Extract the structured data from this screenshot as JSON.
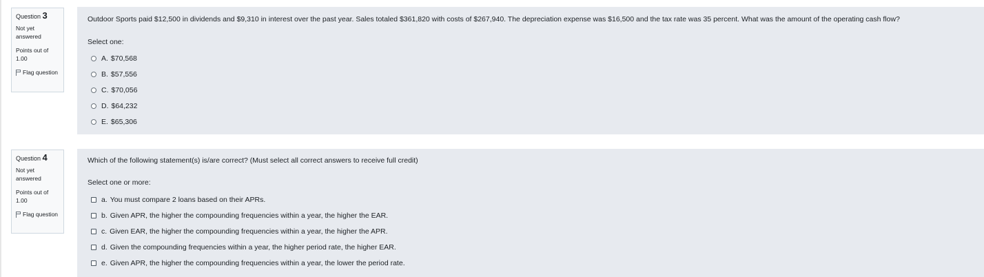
{
  "questions": [
    {
      "number_prefix": "Question",
      "number": "3",
      "state": "Not yet answered",
      "grade": "Points out of 1.00",
      "flag_label": "Flag question",
      "text": "Outdoor Sports paid $12,500 in dividends and $9,310 in interest over the past year. Sales totaled $361,820 with costs of $267,940. The depreciation expense was $16,500 and the tax rate was 35 percent. What was the amount of the operating cash flow?",
      "prompt": "Select one:",
      "options": [
        {
          "letter": "A.",
          "text": "$70,568"
        },
        {
          "letter": "B.",
          "text": "$57,556"
        },
        {
          "letter": "C.",
          "text": "$70,056"
        },
        {
          "letter": "D.",
          "text": "$64,232"
        },
        {
          "letter": "E.",
          "text": "$65,306"
        }
      ]
    },
    {
      "number_prefix": "Question",
      "number": "4",
      "state": "Not yet answered",
      "grade": "Points out of 1.00",
      "flag_label": "Flag question",
      "text": "Which of the following statement(s) is/are correct? (Must select all correct answers to receive full credit)",
      "prompt": "Select one or more:",
      "options": [
        {
          "letter": "a.",
          "text": "You must compare 2 loans based on their APRs."
        },
        {
          "letter": "b.",
          "text": "Given APR, the higher the compounding frequencies within a year, the higher the EAR."
        },
        {
          "letter": "c.",
          "text": "Given EAR, the higher the compounding frequencies within a year, the higher the APR."
        },
        {
          "letter": "d.",
          "text": "Given the compounding frequencies within a year, the higher period rate, the higher EAR."
        },
        {
          "letter": "e.",
          "text": "Given APR, the higher the compounding frequencies within a year, the lower the period rate."
        }
      ]
    }
  ],
  "icons": {
    "flag": "flag-icon",
    "radio": "radio-button",
    "checkbox": "checkbox"
  }
}
